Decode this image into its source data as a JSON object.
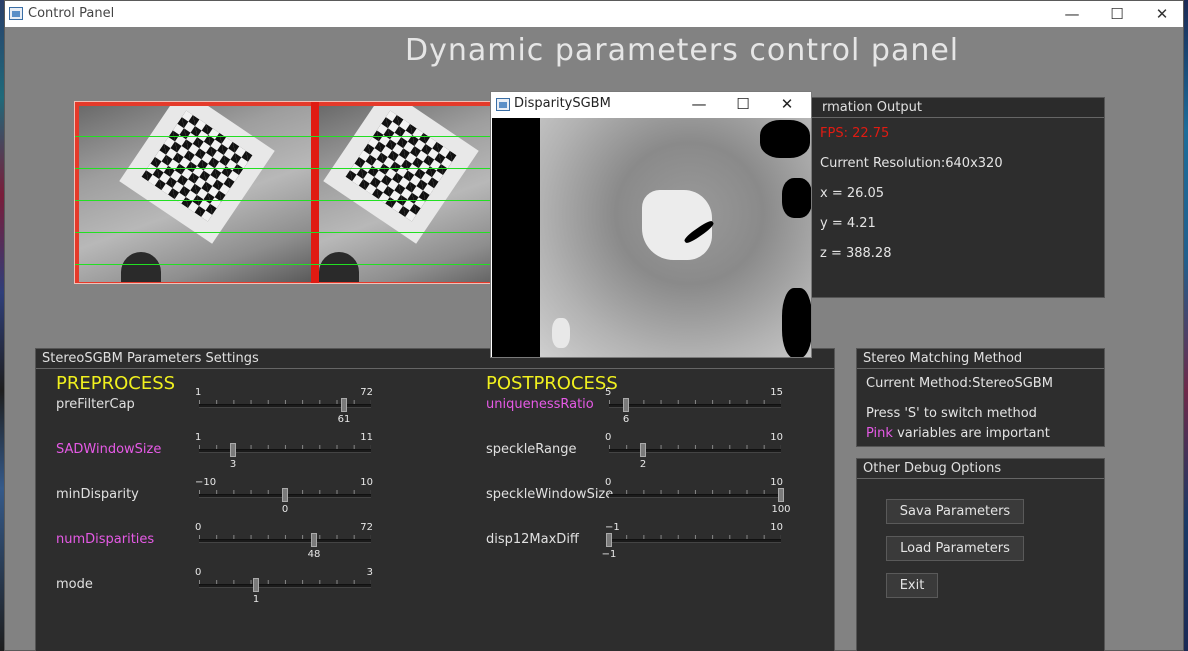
{
  "window": {
    "title": "Control Panel",
    "minimize": "—",
    "maximize": "☐",
    "close": "✕"
  },
  "main_title": "Dynamic parameters control panel",
  "disparity_window": {
    "title": "DisparitySGBM",
    "minimize": "—",
    "maximize": "☐",
    "close": "✕"
  },
  "info": {
    "header": "rmation Output",
    "fps": "FPS: 22.75",
    "resolution": "Current Resolution:640x320",
    "x": "x = 26.05",
    "y": "y = 4.21",
    "z": "z = 388.28"
  },
  "settings": {
    "header": "StereoSGBM Parameters Settings",
    "preprocess_title": "PREPROCESS",
    "postprocess_title": "POSTPROCESS",
    "preprocess": [
      {
        "label": "preFilterCap",
        "important": false,
        "min": "1",
        "max": "72",
        "value": "61",
        "frac": 0.845
      },
      {
        "label": "SADWindowSize",
        "important": true,
        "min": "1",
        "max": "11",
        "value": "3",
        "frac": 0.2
      },
      {
        "label": "minDisparity",
        "important": false,
        "min": "−10",
        "max": "10",
        "value": "0",
        "frac": 0.5
      },
      {
        "label": "numDisparities",
        "important": true,
        "min": "0",
        "max": "72",
        "value": "48",
        "frac": 0.667
      },
      {
        "label": "mode",
        "important": false,
        "min": "0",
        "max": "3",
        "value": "1",
        "frac": 0.333
      }
    ],
    "postprocess": [
      {
        "label": "uniquenessRatio",
        "important": true,
        "min": "5",
        "max": "15",
        "value": "6",
        "frac": 0.1
      },
      {
        "label": "speckleRange",
        "important": false,
        "min": "0",
        "max": "10",
        "value": "2",
        "frac": 0.2
      },
      {
        "label": "speckleWindowSize",
        "important": false,
        "min": "0",
        "max": "10",
        "value": "100",
        "frac": 1.0
      },
      {
        "label": "disp12MaxDiff",
        "important": false,
        "min": "−1",
        "max": "10",
        "value": "−1",
        "frac": 0.0
      }
    ]
  },
  "method": {
    "header": "Stereo Matching Method",
    "current": "Current Method:StereoSGBM",
    "switch_hint": "Press 'S' to switch method",
    "pink_word": "Pink",
    "important_note": " variables are important"
  },
  "debug": {
    "header": "Other Debug Options",
    "save_label": "Sava Parameters",
    "load_label": "Load Parameters",
    "exit_label": "Exit"
  },
  "colors": {
    "section_title": "#f0f01e",
    "important": "#e65ae6",
    "fps": "#e01b12",
    "epipolar_lines": "#22e022"
  }
}
